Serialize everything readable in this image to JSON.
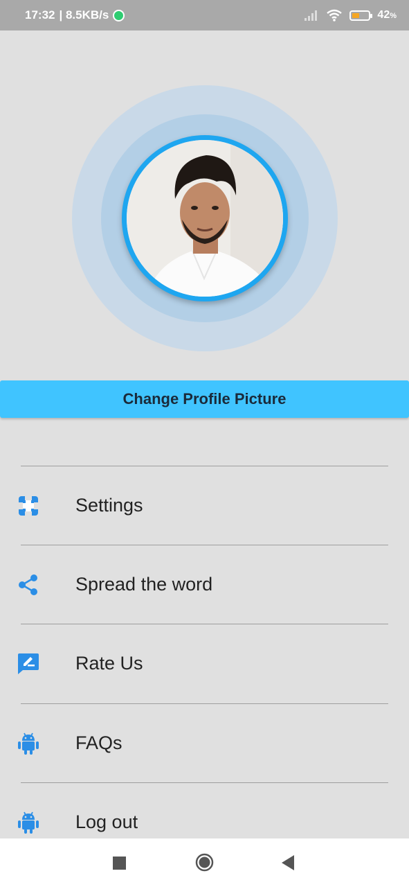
{
  "status_bar": {
    "time": "17:32",
    "speed": "| 8.5KB/s",
    "battery_percent": "42",
    "battery_unit": "%",
    "battery_level": 0.42
  },
  "profile": {
    "change_picture_label": "Change Profile Picture"
  },
  "menu": {
    "items": [
      {
        "label": "Settings",
        "icon": "settings-icon"
      },
      {
        "label": "Spread the word",
        "icon": "share-icon"
      },
      {
        "label": "Rate Us",
        "icon": "rate-icon"
      },
      {
        "label": "FAQs",
        "icon": "android-icon"
      },
      {
        "label": "Log out",
        "icon": "android-icon"
      }
    ]
  },
  "colors": {
    "accent": "#40c4ff",
    "icon": "#2b8ee6",
    "avatar_border": "#1ea6f0"
  }
}
